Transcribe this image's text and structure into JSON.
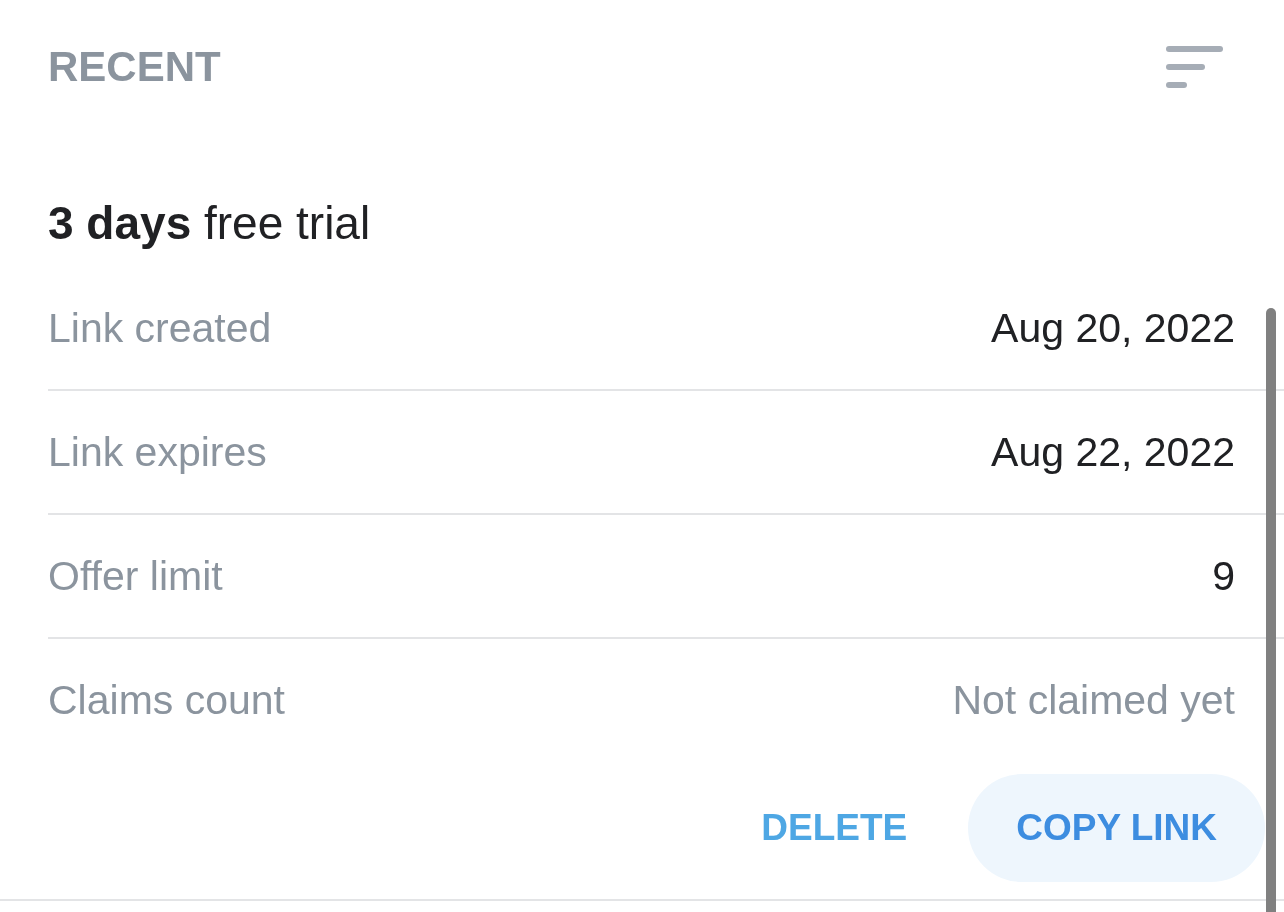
{
  "header": {
    "title": "RECENT"
  },
  "offer": {
    "title": "**3 days** free trial",
    "details": [
      {
        "label": "Link created",
        "value": "Aug 20, 2022",
        "muted": false
      },
      {
        "label": "Link expires",
        "value": "Aug 22, 2022",
        "muted": false
      },
      {
        "label": "Offer limit",
        "value": "9",
        "muted": false
      },
      {
        "label": "Claims count",
        "value": "Not claimed yet",
        "muted": true
      }
    ]
  },
  "actions": [
    {
      "label": "DELETE",
      "kind": "text"
    },
    {
      "label": "COPY LINK",
      "kind": "tonal"
    }
  ]
}
